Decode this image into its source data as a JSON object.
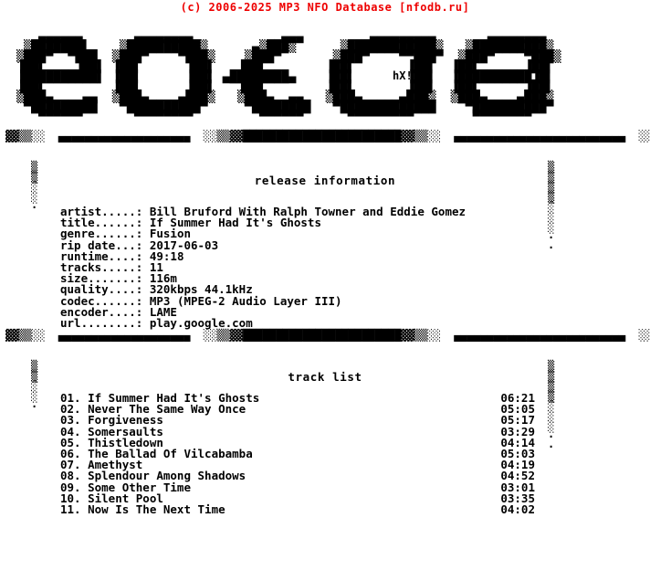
{
  "copyright": "(c) 2006-2025 MP3 NFO Database [nfodb.ru]",
  "logo": {
    "word": "entitled",
    "signature": "hX!",
    "art": "   ▄▄▄▄▄▄       ▄▄▄▄▄▄▄▄            ▄▄▄         ▄▄▄▄▄▄▄▄▄       ▄▄▄▄▄▄▄▄\n ▒███████▌    ▒██████████▒      ▄▒███▒      ▒████████████▒   ▒██████████▒\n▒███▀  ▀███  ▒███▀    ▀███▒    ▒███▀       ▒███▀    ▀▀███▀  ▒███▀    ▀███▒\n▐██▌    ▐██▌ ▐██▌      ▐██▌   ▐██▌        ▐██▌       ▐██▌  ▐██▌      ▐██▌\n▐██████████▌ ▐██▌      ▐██▌ ▄████████▄    ▐██▌       ▐██▌  ▐██████████▐█▌\n▐██▌         ▐██▌      ▐██▌   ▐██▌        ▐██▌       ▐██▌  ▐██▌      ▐██▌\n▒███▄    ▄▄  ▒███▄    ▄███▒   ▒███▄  ▄▄   ▒███▄     ▄███▒  ▒███▄    ▄███▒\n ▀█████████   ▀██████████▀     ▀████████   ▀█████████████    ▀██████████▀\n   ▀▀▀▀▀▀       ▀▀▀▀▀▀▀▀         ▀▀▀▀▀▀      ▀▀▀▀▀▀▀▀▀        ▀▀▀▀▀▀▀▀"
  },
  "dividers": {
    "bar": "▓▓▒▒░░  ▄▄▄▄▄▄▄▄▄▄▄▄▄▄▄▄▄▄▄▄  ░░▒▒▓▓████████████████████████▓▓▒▒░░  ▄▄▄▄▄▄▄▄▄▄▄▄▄▄▄▄▄▄▄▄▄▄▄▄▄▄  ░░▒▒▓▓███████████████████▓▓▒▒░░"
  },
  "rails": {
    "left": "▒\n▒\n░\n░\n·",
    "right": "▒\n▒\n▒\n▒\n░\n░\n░\n·\n·"
  },
  "sections": {
    "release_heading": "release information",
    "track_heading": "track list"
  },
  "release_info": [
    {
      "label": "artist.....:",
      "value": "Bill Bruford With Ralph Towner and Eddie Gomez"
    },
    {
      "label": "title......:",
      "value": "If Summer Had It's Ghosts"
    },
    {
      "label": "genre......:",
      "value": "Fusion"
    },
    {
      "label": "rip date...:",
      "value": "2017-06-03"
    },
    {
      "label": "runtime....:",
      "value": "49:18"
    },
    {
      "label": "tracks.....:",
      "value": "11"
    },
    {
      "label": "size.......:",
      "value": "116m"
    },
    {
      "label": "quality....:",
      "value": "320kbps 44.1kHz"
    },
    {
      "label": "codec......:",
      "value": "MP3 (MPEG-2 Audio Layer III)"
    },
    {
      "label": "encoder....:",
      "value": "LAME"
    },
    {
      "label": "url........:",
      "value": "play.google.com"
    }
  ],
  "tracks": [
    {
      "num": "01.",
      "title": "If Summer Had It's Ghosts",
      "time": "06:21"
    },
    {
      "num": "02.",
      "title": "Never The Same Way Once",
      "time": "05:05"
    },
    {
      "num": "03.",
      "title": "Forgiveness",
      "time": "05:17"
    },
    {
      "num": "04.",
      "title": "Somersaults",
      "time": "03:29"
    },
    {
      "num": "05.",
      "title": "Thistledown",
      "time": "04:14"
    },
    {
      "num": "06.",
      "title": "The Ballad Of Vilcabamba",
      "time": "05:03"
    },
    {
      "num": "07.",
      "title": "Amethyst",
      "time": "04:19"
    },
    {
      "num": "08.",
      "title": "Splendour Among Shadows",
      "time": "04:52"
    },
    {
      "num": "09.",
      "title": "Some Other Time",
      "time": "03:01"
    },
    {
      "num": "10.",
      "title": "Silent Pool",
      "time": "03:35"
    },
    {
      "num": "11.",
      "title": "Now Is The Next Time",
      "time": "04:02"
    }
  ],
  "colors": {
    "copyright_red": "#ee0000",
    "text_black": "#000000",
    "background": "#ffffff"
  }
}
